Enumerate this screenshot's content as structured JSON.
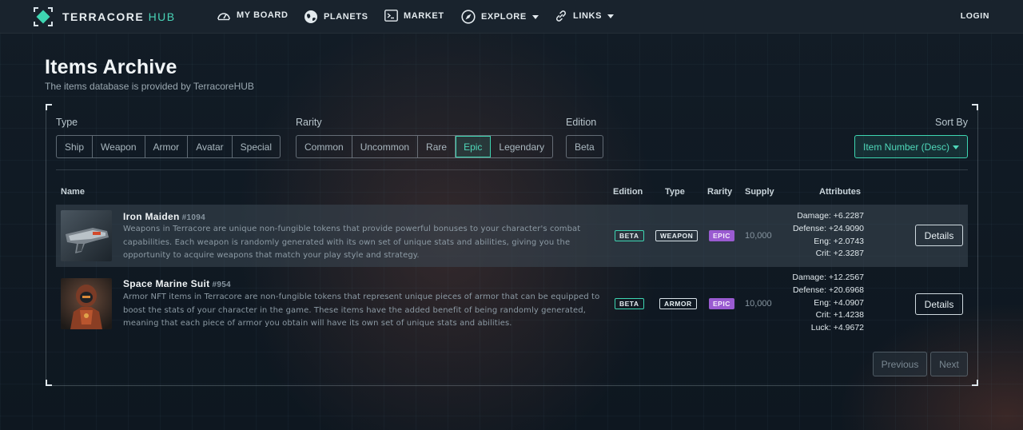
{
  "nav": {
    "brand_main": "TERRACORE",
    "brand_hub": "HUB",
    "items": [
      {
        "label": "MY BOARD",
        "icon": "dashboard-icon"
      },
      {
        "label": "PLANETS",
        "icon": "globe-icon"
      },
      {
        "label": "MARKET",
        "icon": "terminal-icon"
      },
      {
        "label": "EXPLORE",
        "icon": "compass-icon"
      },
      {
        "label": "LINKS",
        "icon": "link-icon"
      }
    ],
    "login": "LOGIN"
  },
  "header": {
    "title": "Items Archive",
    "subtitle": "The items database is provided by TerracoreHUB"
  },
  "filters": {
    "type_label": "Type",
    "types": [
      "Ship",
      "Weapon",
      "Armor",
      "Avatar",
      "Special"
    ],
    "rarity_label": "Rarity",
    "rarities": [
      "Common",
      "Uncommon",
      "Rare",
      "Epic",
      "Legendary"
    ],
    "rarity_selected": "Epic",
    "edition_label": "Edition",
    "editions": [
      "Beta"
    ],
    "sort_label": "Sort By",
    "sort_value": "Item Number (Desc)"
  },
  "table": {
    "headers": {
      "name": "Name",
      "edition": "Edition",
      "type": "Type",
      "rarity": "Rarity",
      "supply": "Supply",
      "attributes": "Attributes"
    },
    "rows": [
      {
        "name": "Iron Maiden",
        "number": "#1094",
        "description": "Weapons in Terracore are unique non-fungible tokens that provide powerful bonuses to your character's combat capabilities. Each weapon is randomly generated with its own set of unique stats and abilities, giving you the opportunity to acquire weapons that match your play style and strategy.",
        "edition": "BETA",
        "type": "WEAPON",
        "rarity": "EPIC",
        "supply": "10,000",
        "attributes": [
          "Damage: +6.2287",
          "Defense: +24.9090",
          "Eng: +2.0743",
          "Crit: +2.3287"
        ],
        "action": "Details"
      },
      {
        "name": "Space Marine Suit",
        "number": "#954",
        "description": "Armor NFT items in Terracore are non-fungible tokens that represent unique pieces of armor that can be equipped to boost the stats of your character in the game. These items have the added benefit of being randomly generated, meaning that each piece of armor you obtain will have its own set of unique stats and abilities.",
        "edition": "BETA",
        "type": "ARMOR",
        "rarity": "EPIC",
        "supply": "10,000",
        "attributes": [
          "Damage: +12.2567",
          "Defense: +20.6968",
          "Eng: +4.0907",
          "Crit: +1.4238",
          "Luck: +4.9672"
        ],
        "action": "Details"
      }
    ]
  },
  "pagination": {
    "previous": "Previous",
    "next": "Next"
  },
  "colors": {
    "accent": "#3ed6b2",
    "epic": "#9a5bd1",
    "background": "#121c26"
  }
}
